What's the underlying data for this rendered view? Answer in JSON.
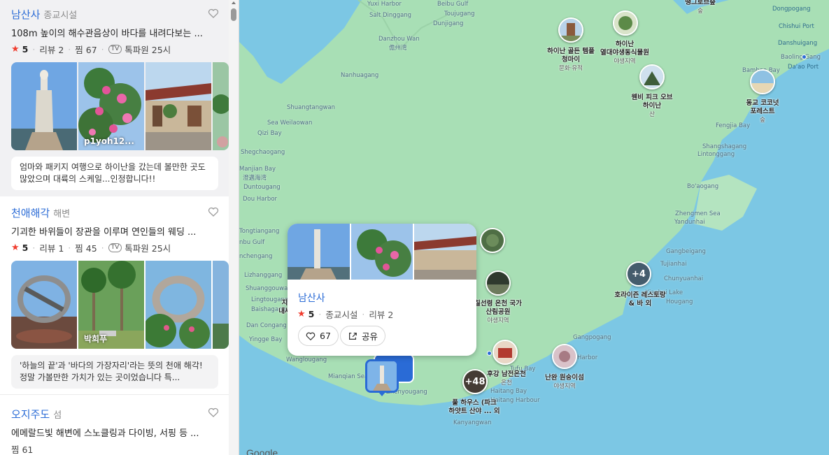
{
  "sidebar": {
    "cards": [
      {
        "name": "남산사",
        "category": "종교시설",
        "description": "108m 높이의 해수관음상이 바다를 내려다보는 ...",
        "rating": "5",
        "reviews": "리뷰 2",
        "saves": "찜 67",
        "tv_label": "TV",
        "tv_source": "톡파원 25시",
        "photo_caption": "p1yoh12...",
        "review_text": "엄마와 패키지 여행으로 하이난을 갔는데 볼만한 곳도 많았으며 대륙의 스케일...인정합니다!!"
      },
      {
        "name": "천애해각",
        "category": "해변",
        "description": "기괴한 바위들이 장관을 이루며 연인들의 웨딩 ...",
        "rating": "5",
        "reviews": "리뷰 1",
        "saves": "찜 45",
        "tv_label": "TV",
        "tv_source": "톡파원 25시",
        "photo_caption": "박희푸",
        "review_text": "'하늘의 끝'과 '바다의 가장자리'라는 뜻의 천애 해각! 정말 가볼만한 가치가 있는 곳이었습니다 특..."
      },
      {
        "name": "오지주도",
        "category": "섬",
        "description": "에메랄드빛 해변에 스노클링과 다이빙, 서핑 등 ...",
        "saves": "찜 61"
      }
    ]
  },
  "popup": {
    "name": "남산사",
    "rating": "5",
    "category": "종교시설",
    "reviews": "리뷰 2",
    "likes": "67",
    "share": "공유"
  },
  "map": {
    "labels": [
      "Yuxi Harbor",
      "Beibu Gulf",
      "Salt Dinggang",
      "Toujugang",
      "Dunjigang",
      "Danzhou Wan",
      "儋州湾",
      "Nanhuagang",
      "Shuangtangwan",
      "Sea Weilaowan",
      "Qizi Bay",
      "Shegchaogang",
      "Manjian Bay",
      "澄邁海湾",
      "Duntougang",
      "Dou Harbor",
      "Tongtiangang",
      "nbu Gulf",
      "nchengang",
      "Lizhanggang",
      "Shuanggouwan",
      "Lingtougang",
      "Baishagang",
      "Dan Congang",
      "Yingge Bay",
      "Wanglougang",
      "Mianqian Sea",
      "Zhenyougang",
      "Kanyangwan",
      "Haitang Bay",
      "Tufu Bay",
      "Gangpogang",
      "Harbor",
      "Dongpogang",
      "Chishui Port",
      "Danshuigang",
      "Baoling Gang",
      "Da'ao Port",
      "Bamboo Bay",
      "Fengjia Bay",
      "Shangshagang",
      "Lintonggang",
      "Bo'aogang",
      "Zhengmen Sea",
      "Yandunhai",
      "Gangbeigang",
      "Tujianhai",
      "Chunyuanhai",
      "Xiaohai Lake",
      "Hougang",
      "Haitang Harbour"
    ],
    "pois": [
      {
        "name": "하이난 골든 템플\n청마이",
        "sub": "문화·유적"
      },
      {
        "name": "하이난\n열대야생동식물원",
        "sub": "야생지역"
      },
      {
        "name": "웬비 피크 오브\n하이난",
        "sub": "산"
      },
      {
        "name": "하이커우\n땡그로브숲",
        "sub": "숲"
      },
      {
        "name": "동교 코코넛\n포레스트",
        "sub": "숲"
      },
      {
        "name": "호라이즌 레스토랑\n& 바 외",
        "sub": ""
      },
      {
        "name": "칠선령 온천 국가\n산림공원",
        "sub": "야생지역"
      },
      {
        "name": "후강 남전온천",
        "sub": "온천"
      },
      {
        "name": "난완 원숭이섬",
        "sub": "야생지역"
      },
      {
        "name": "풀 하우스 (파크\n하얏트 산야 ... 외",
        "sub": ""
      },
      {
        "name": "지\n내세",
        "sub": ""
      }
    ],
    "cluster_counts": [
      "+4",
      "+48"
    ],
    "google": "Google"
  },
  "colors": {
    "accent": "#2a6bd6",
    "star": "#f03c2e",
    "sea": "#7cc7e4",
    "land": "#a8dfb5"
  },
  "icons": {
    "heart": "heart-outline-icon",
    "share": "share-icon",
    "star": "star-icon",
    "tv": "tv-badge-icon"
  }
}
